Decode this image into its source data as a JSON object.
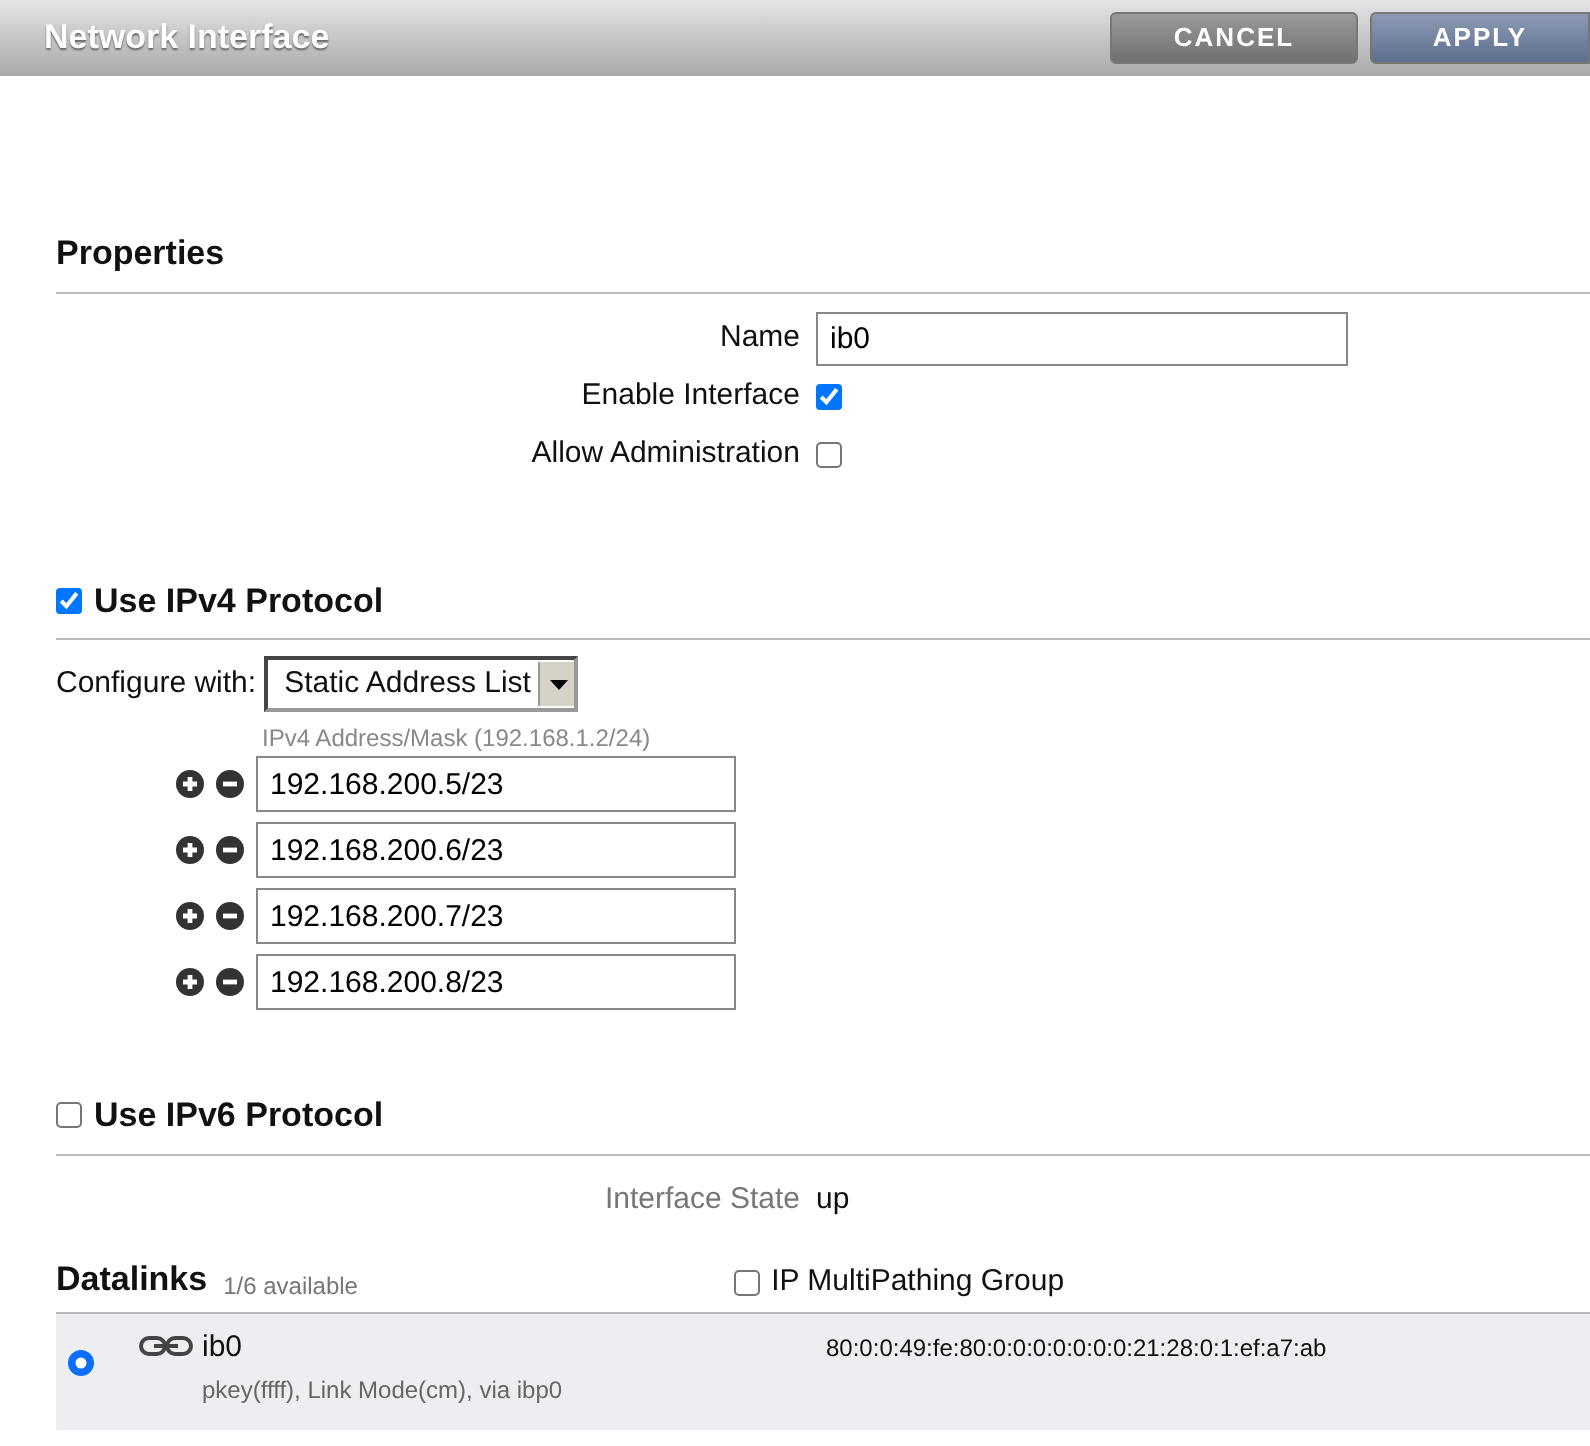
{
  "header": {
    "title": "Network Interface",
    "buttons": [
      {
        "label": "CANCEL",
        "kind": "cancel"
      },
      {
        "label": "APPLY",
        "kind": "apply"
      }
    ]
  },
  "properties": {
    "heading": "Properties",
    "name_label": "Name",
    "name_value": "ib0",
    "enable_label": "Enable Interface",
    "enable_checked": true,
    "admin_label": "Allow Administration",
    "admin_checked": false
  },
  "ipv4": {
    "heading": "Use IPv4 Protocol",
    "checked": true,
    "configure_label": "Configure with:",
    "configure_value": "Static Address List",
    "address_hint": "IPv4 Address/Mask (192.168.1.2/24)",
    "addresses": [
      "192.168.200.5/23",
      "192.168.200.6/23",
      "192.168.200.7/23",
      "192.168.200.8/23"
    ]
  },
  "ipv6": {
    "heading": "Use IPv6 Protocol",
    "checked": false
  },
  "state": {
    "label": "Interface State",
    "value": "up"
  },
  "datalinks": {
    "heading": "Datalinks",
    "count": "1/6 available",
    "multipath_label": "IP MultiPathing Group",
    "multipath_checked": false,
    "items": [
      {
        "name": "ib0",
        "detail": "pkey(ffff), Link Mode(cm), via ibp0",
        "address": "80:0:0:49:fe:80:0:0:0:0:0:0:0:21:28:0:1:ef:a7:ab",
        "selected": true
      }
    ]
  }
}
